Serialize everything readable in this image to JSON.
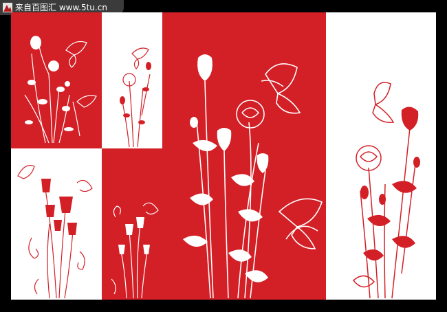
{
  "watermark": {
    "text": "来自百图汇  www.5tu.cn"
  },
  "colors": {
    "red": "#d31f26",
    "white": "#ffffff",
    "frame": "#000000"
  },
  "artwork": {
    "panels": [
      {
        "name": "panel-rose-bouquet-top-left",
        "bg": "red",
        "motif": "rose-and-butterfly"
      },
      {
        "name": "panel-rose-bouquet-top-middle",
        "bg": "white",
        "motif": "rose-and-butterfly"
      },
      {
        "name": "panel-tulips-bottom-left",
        "bg": "white",
        "motif": "tulip-swirls"
      },
      {
        "name": "panel-tulips-bottom-middle",
        "bg": "red",
        "motif": "tulip-swirls"
      },
      {
        "name": "panel-roses-center-large",
        "bg": "red",
        "motif": "rose-and-butterfly"
      },
      {
        "name": "panel-rose-right",
        "bg": "white",
        "motif": "rose-and-butterfly"
      }
    ]
  }
}
